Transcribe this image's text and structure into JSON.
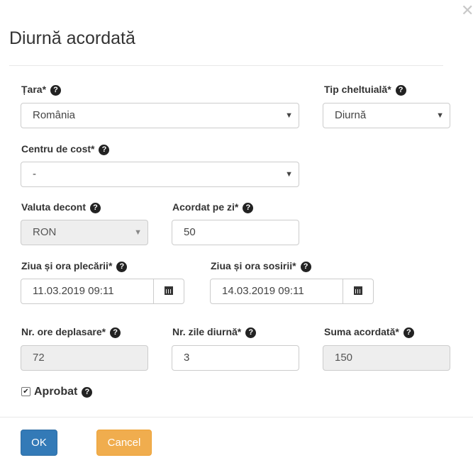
{
  "dialog": {
    "title": "Diurnă acordată",
    "close_icon": "close-icon"
  },
  "fields": {
    "tara": {
      "label": "Țara*",
      "value": "România"
    },
    "tip_cheltuiala": {
      "label": "Tip cheltuială*",
      "value": "Diurnă"
    },
    "centru_cost": {
      "label": "Centru de cost*",
      "value": "-"
    },
    "valuta": {
      "label": "Valuta decont",
      "value": "RON"
    },
    "acordat_pe_zi": {
      "label": "Acordat pe zi*",
      "value": "50"
    },
    "plecare": {
      "label": "Ziua și ora plecării*",
      "value": "11.03.2019 09:11"
    },
    "sosire": {
      "label": "Ziua și ora sosirii*",
      "value": "14.03.2019 09:11"
    },
    "ore_deplasare": {
      "label": "Nr. ore deplasare*",
      "value": "72"
    },
    "zile_diurna": {
      "label": "Nr. zile diurnă*",
      "value": "3"
    },
    "suma_acordata": {
      "label": "Suma acordată*",
      "value": "150"
    },
    "aprobat": {
      "label": "Aprobat",
      "checked": true
    }
  },
  "buttons": {
    "ok": "OK",
    "cancel": "Cancel"
  },
  "colors": {
    "primary": "#337ab7",
    "warning": "#f0ad4e",
    "readonly_bg": "#eeeeee"
  }
}
